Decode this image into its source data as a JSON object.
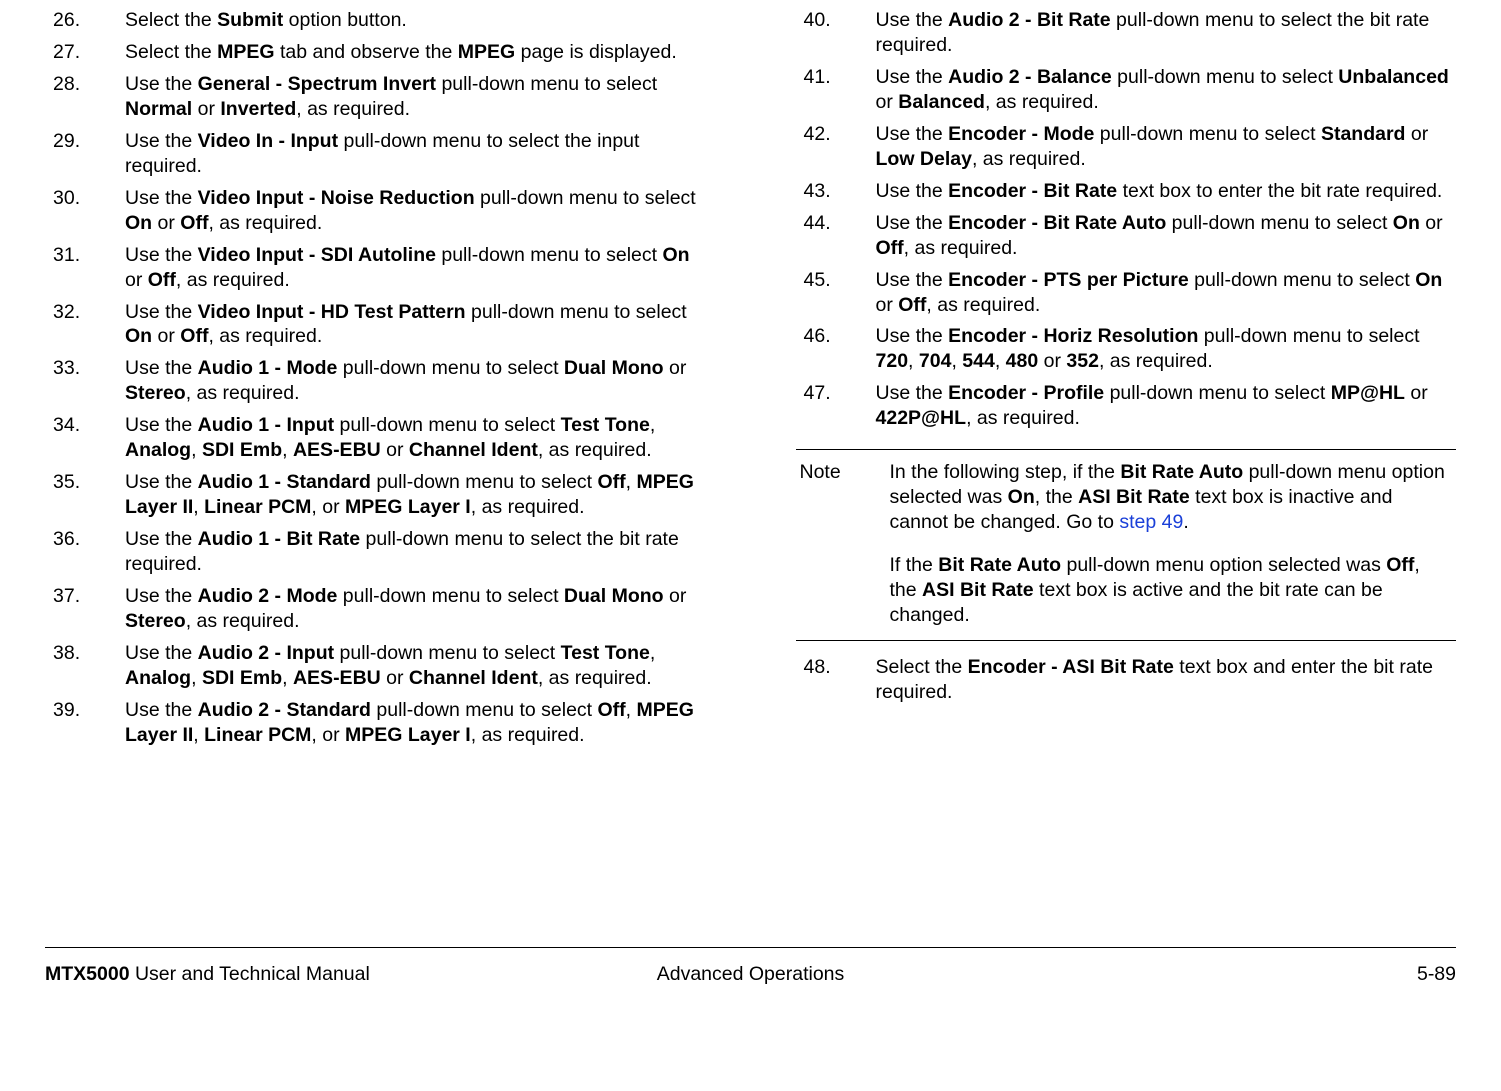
{
  "left_column": [
    {
      "n": "26.",
      "parts": [
        "Select the ",
        {
          "b": "Submit"
        },
        " option button."
      ]
    },
    {
      "n": "27.",
      "parts": [
        "Select the ",
        {
          "b": "MPEG"
        },
        " tab and observe the ",
        {
          "b": "MPEG"
        },
        " page is displayed."
      ]
    },
    {
      "n": "28.",
      "parts": [
        "Use the ",
        {
          "b": "General - Spectrum Invert"
        },
        " pull-down menu to select ",
        {
          "b": "Normal"
        },
        " or ",
        {
          "b": "Inverted"
        },
        ", as required."
      ]
    },
    {
      "n": "29.",
      "parts": [
        "Use the ",
        {
          "b": "Video In - Input"
        },
        " pull-down menu to select the input required."
      ]
    },
    {
      "n": "30.",
      "parts": [
        "Use the ",
        {
          "b": "Video Input - Noise Reduction"
        },
        " pull-down menu to select ",
        {
          "b": "On"
        },
        " or ",
        {
          "b": "Off"
        },
        ", as required."
      ]
    },
    {
      "n": "31.",
      "parts": [
        "Use the ",
        {
          "b": "Video Input - SDI Autoline"
        },
        " pull-down menu to select ",
        {
          "b": "On"
        },
        " or ",
        {
          "b": "Off"
        },
        ", as required."
      ]
    },
    {
      "n": "32.",
      "parts": [
        "Use the ",
        {
          "b": "Video Input - HD Test Pattern"
        },
        " pull-down menu to select ",
        {
          "b": "On"
        },
        " or ",
        {
          "b": "Off"
        },
        ", as required."
      ]
    },
    {
      "n": "33.",
      "parts": [
        "Use the ",
        {
          "b": "Audio 1 - Mode"
        },
        " pull-down menu to select ",
        {
          "b": "Dual Mono"
        },
        " or ",
        {
          "b": "Stereo"
        },
        ", as required."
      ]
    },
    {
      "n": "34.",
      "parts": [
        "Use the ",
        {
          "b": "Audio 1 - Input"
        },
        " pull-down menu to select ",
        {
          "b": "Test Tone"
        },
        ", ",
        {
          "b": "Analog"
        },
        ", ",
        {
          "b": "SDI Emb"
        },
        ", ",
        {
          "b": "AES-EBU"
        },
        " or ",
        {
          "b": "Channel Ident"
        },
        ", as required."
      ]
    },
    {
      "n": "35.",
      "parts": [
        "Use the ",
        {
          "b": "Audio 1 - Standard"
        },
        " pull-down menu to select ",
        {
          "b": "Off"
        },
        ", ",
        {
          "b": "MPEG Layer II"
        },
        ", ",
        {
          "b": "Linear PCM"
        },
        ", or ",
        {
          "b": "MPEG Layer I"
        },
        ", as required."
      ]
    },
    {
      "n": "36.",
      "parts": [
        "Use the ",
        {
          "b": "Audio 1 - Bit Rate"
        },
        " pull-down menu to select the bit rate required."
      ]
    },
    {
      "n": "37.",
      "parts": [
        "Use the ",
        {
          "b": "Audio 2 - Mode"
        },
        " pull-down menu to select ",
        {
          "b": "Dual Mono"
        },
        " or ",
        {
          "b": "Stereo"
        },
        ", as required."
      ]
    },
    {
      "n": "38.",
      "parts": [
        "Use the ",
        {
          "b": "Audio 2 - Input"
        },
        " pull-down menu to select ",
        {
          "b": "Test Tone"
        },
        ", ",
        {
          "b": "Analog"
        },
        ", ",
        {
          "b": "SDI Emb"
        },
        ", ",
        {
          "b": "AES-EBU"
        },
        " or ",
        {
          "b": "Channel Ident"
        },
        ", as required."
      ]
    },
    {
      "n": "39.",
      "parts": [
        "Use the ",
        {
          "b": "Audio 2 - Standard"
        },
        " pull-down menu to select ",
        {
          "b": "Off"
        },
        ", ",
        {
          "b": "MPEG Layer II"
        },
        ", ",
        {
          "b": "Linear PCM"
        },
        ", or ",
        {
          "b": "MPEG Layer I"
        },
        ", as required."
      ]
    }
  ],
  "right_top": [
    {
      "n": "40.",
      "parts": [
        "Use the ",
        {
          "b": "Audio 2 - Bit Rate"
        },
        " pull-down menu to select the bit rate required."
      ]
    },
    {
      "n": "41.",
      "parts": [
        "Use the ",
        {
          "b": "Audio 2 - Balance"
        },
        " pull-down menu to select ",
        {
          "b": "Unbalanced"
        },
        " or ",
        {
          "b": "Balanced"
        },
        ", as required."
      ]
    },
    {
      "n": "42.",
      "parts": [
        "Use the ",
        {
          "b": "Encoder - Mode"
        },
        " pull-down menu to select ",
        {
          "b": "Standard"
        },
        " or ",
        {
          "b": "Low Delay"
        },
        ", as required."
      ]
    },
    {
      "n": "43.",
      "parts": [
        "Use the ",
        {
          "b": "Encoder - Bit Rate"
        },
        " text box to enter the bit rate required."
      ]
    },
    {
      "n": "44.",
      "parts": [
        "Use the ",
        {
          "b": "Encoder - Bit Rate Auto"
        },
        " pull-down menu to select ",
        {
          "b": "On"
        },
        " or ",
        {
          "b": "Off"
        },
        ", as required."
      ]
    },
    {
      "n": "45.",
      "parts": [
        "Use the ",
        {
          "b": "Encoder - PTS per Picture"
        },
        " pull-down menu to select ",
        {
          "b": "On"
        },
        " or ",
        {
          "b": "Off"
        },
        ", as required."
      ]
    },
    {
      "n": "46.",
      "parts": [
        "Use the ",
        {
          "b": "Encoder - Horiz Resolution"
        },
        " pull-down menu to select ",
        {
          "b": "720"
        },
        ", ",
        {
          "b": "704"
        },
        ", ",
        {
          "b": "544"
        },
        ", ",
        {
          "b": "480"
        },
        " or ",
        {
          "b": "352"
        },
        ", as required."
      ]
    },
    {
      "n": "47.",
      "parts": [
        "Use the ",
        {
          "b": "Encoder - Profile"
        },
        " pull-down menu to select ",
        {
          "b": "MP@HL"
        },
        " or ",
        {
          "b": "422P@HL"
        },
        ", as required."
      ]
    }
  ],
  "note": {
    "label": "Note",
    "paragraphs": [
      {
        "parts": [
          "In the following step, if the ",
          {
            "b": "Bit Rate Auto"
          },
          " pull-down menu option selected was ",
          {
            "b": "On"
          },
          ", the ",
          {
            "b": "ASI Bit Rate"
          },
          " text box is inactive and cannot be changed.  Go to ",
          {
            "link": "step 49"
          },
          "."
        ]
      },
      {
        "parts": [
          "If the ",
          {
            "b": "Bit Rate Auto"
          },
          " pull-down menu option selected was ",
          {
            "b": "Off"
          },
          ", the ",
          {
            "b": "ASI Bit Rate"
          },
          " text box is active and the bit rate can be changed."
        ]
      }
    ]
  },
  "right_bottom": [
    {
      "n": "48.",
      "parts": [
        "Select the ",
        {
          "b": "Encoder - ASI Bit Rate"
        },
        " text box and enter the bit rate required."
      ]
    }
  ],
  "footer": {
    "left_bold": "MTX5000",
    "left_rest": " User and Technical Manual",
    "center": "Advanced Operations",
    "right": "5-89"
  }
}
